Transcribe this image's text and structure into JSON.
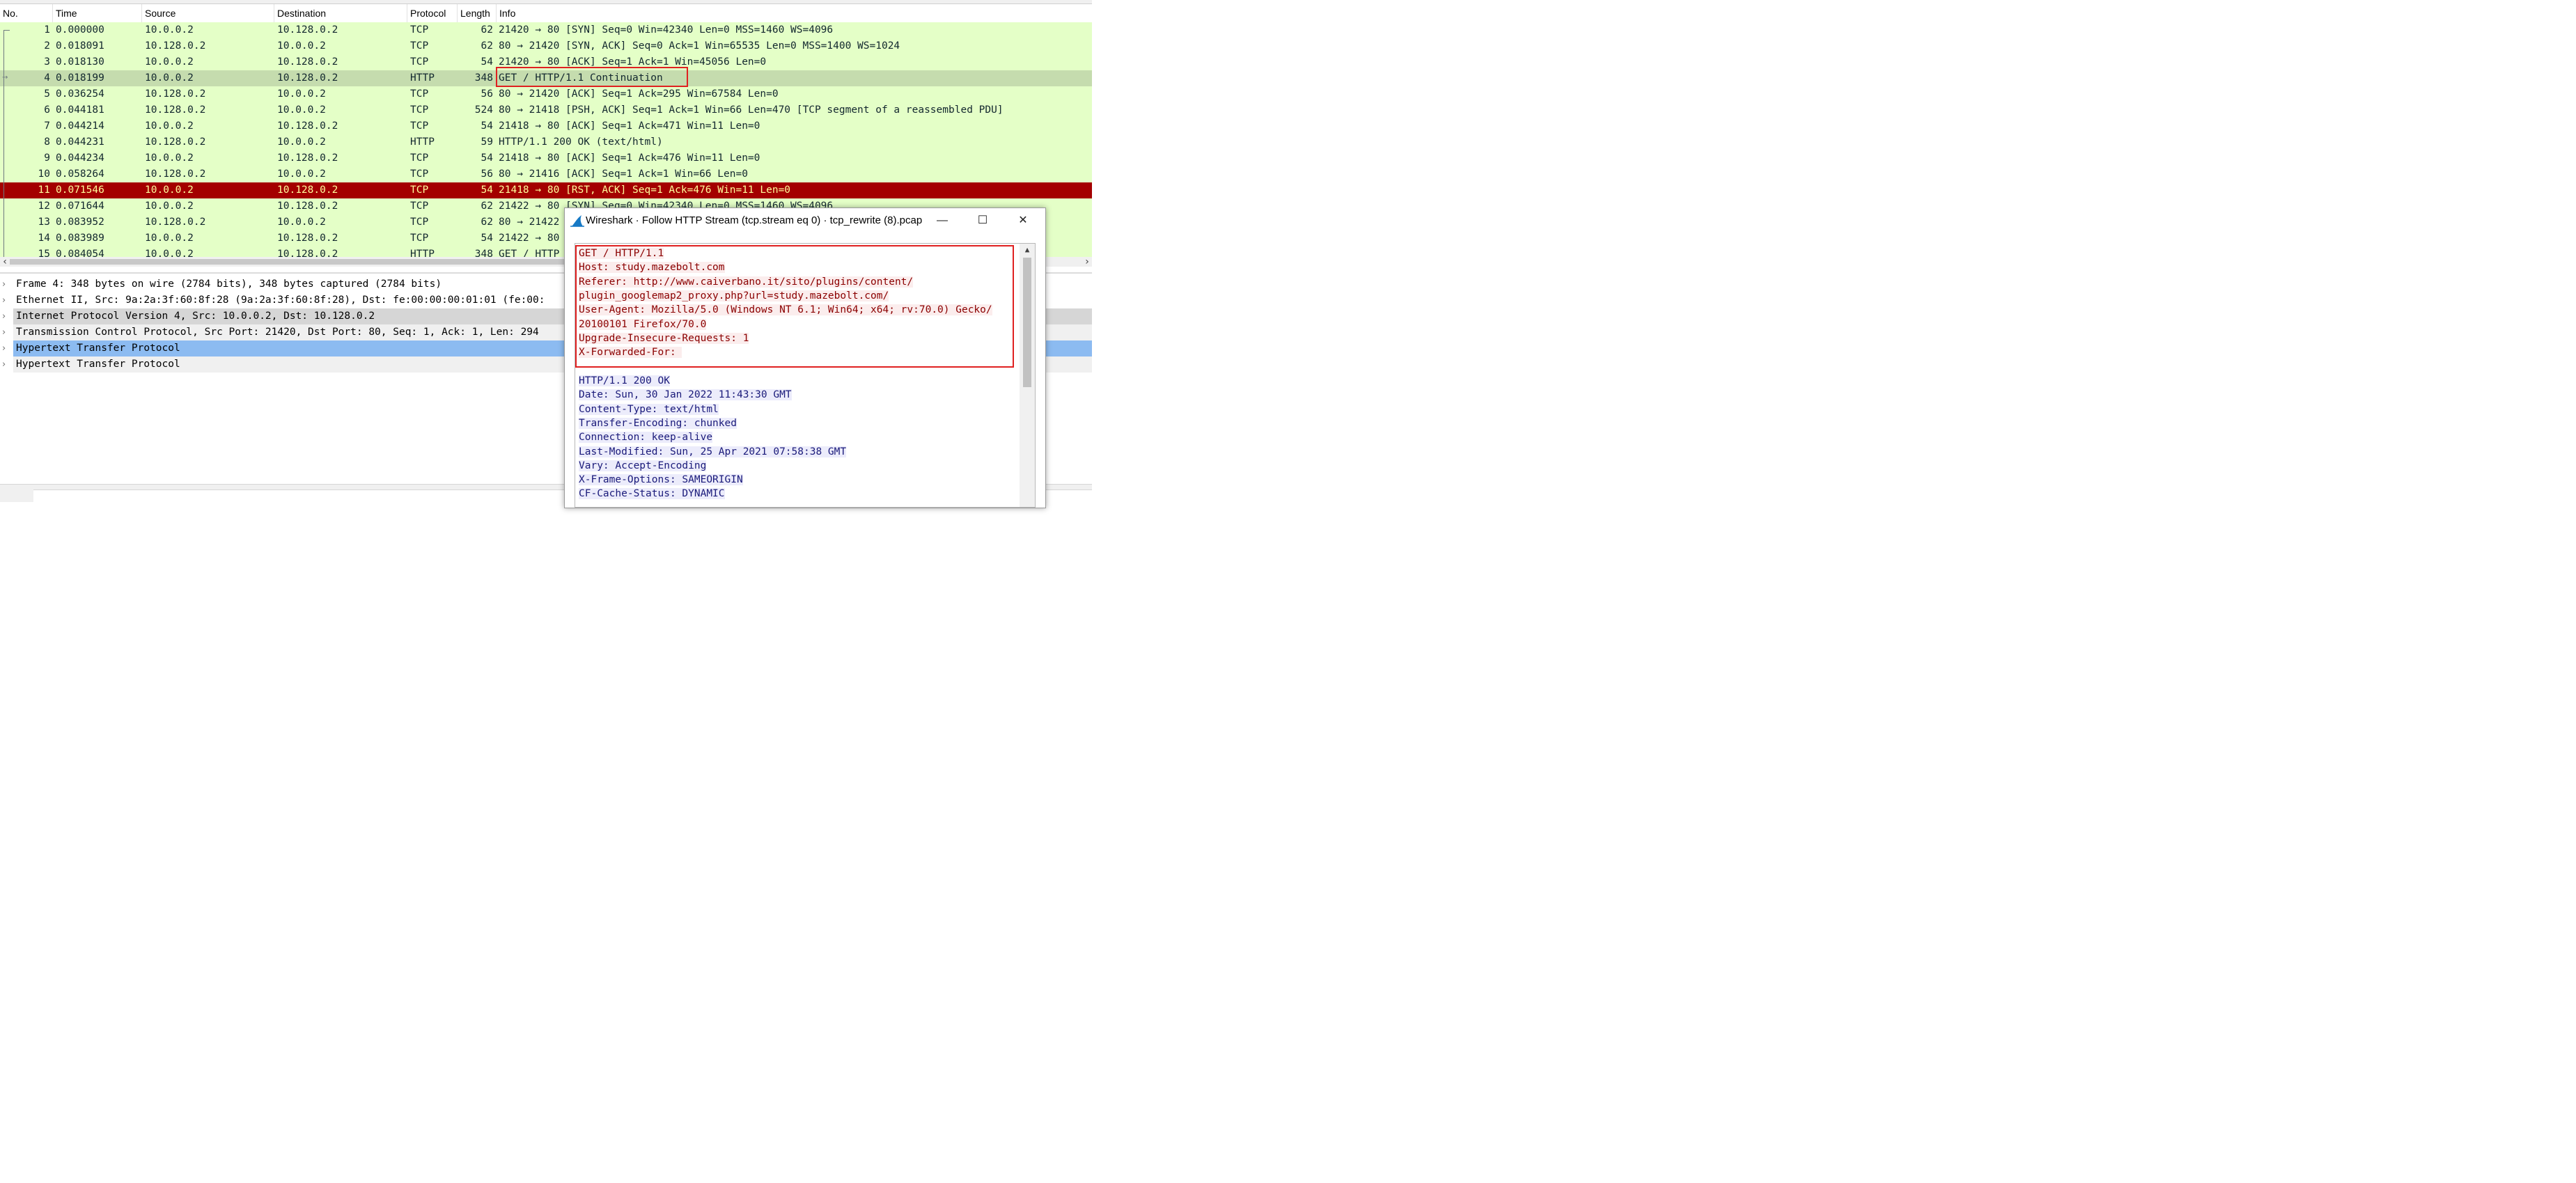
{
  "packet_list": {
    "columns": [
      "No.",
      "Time",
      "Source",
      "Destination",
      "Protocol",
      "Length",
      "Info"
    ],
    "rows": [
      {
        "no": "1",
        "time": "0.000000",
        "src": "10.0.0.2",
        "dst": "10.128.0.2",
        "proto": "TCP",
        "len": "62",
        "info": "21420 → 80 [SYN] Seq=0 Win=42340 Len=0 MSS=1460 WS=4096"
      },
      {
        "no": "2",
        "time": "0.018091",
        "src": "10.128.0.2",
        "dst": "10.0.0.2",
        "proto": "TCP",
        "len": "62",
        "info": "80 → 21420 [SYN, ACK] Seq=0 Ack=1 Win=65535 Len=0 MSS=1400 WS=1024"
      },
      {
        "no": "3",
        "time": "0.018130",
        "src": "10.0.0.2",
        "dst": "10.128.0.2",
        "proto": "TCP",
        "len": "54",
        "info": "21420 → 80 [ACK] Seq=1 Ack=1 Win=45056 Len=0"
      },
      {
        "no": "4",
        "time": "0.018199",
        "src": "10.0.0.2",
        "dst": "10.128.0.2",
        "proto": "HTTP",
        "len": "348",
        "info": "GET / HTTP/1.1 Continuation"
      },
      {
        "no": "5",
        "time": "0.036254",
        "src": "10.128.0.2",
        "dst": "10.0.0.2",
        "proto": "TCP",
        "len": "56",
        "info": "80 → 21420 [ACK] Seq=1 Ack=295 Win=67584 Len=0"
      },
      {
        "no": "6",
        "time": "0.044181",
        "src": "10.128.0.2",
        "dst": "10.0.0.2",
        "proto": "TCP",
        "len": "524",
        "info": "80 → 21418 [PSH, ACK] Seq=1 Ack=1 Win=66 Len=470 [TCP segment of a reassembled PDU]"
      },
      {
        "no": "7",
        "time": "0.044214",
        "src": "10.0.0.2",
        "dst": "10.128.0.2",
        "proto": "TCP",
        "len": "54",
        "info": "21418 → 80 [ACK] Seq=1 Ack=471 Win=11 Len=0"
      },
      {
        "no": "8",
        "time": "0.044231",
        "src": "10.128.0.2",
        "dst": "10.0.0.2",
        "proto": "HTTP",
        "len": "59",
        "info": "HTTP/1.1 200 OK  (text/html)"
      },
      {
        "no": "9",
        "time": "0.044234",
        "src": "10.0.0.2",
        "dst": "10.128.0.2",
        "proto": "TCP",
        "len": "54",
        "info": "21418 → 80 [ACK] Seq=1 Ack=476 Win=11 Len=0"
      },
      {
        "no": "10",
        "time": "0.058264",
        "src": "10.128.0.2",
        "dst": "10.0.0.2",
        "proto": "TCP",
        "len": "56",
        "info": "80 → 21416 [ACK] Seq=1 Ack=1 Win=66 Len=0"
      },
      {
        "no": "11",
        "time": "0.071546",
        "src": "10.0.0.2",
        "dst": "10.128.0.2",
        "proto": "TCP",
        "len": "54",
        "info": "21418 → 80 [RST, ACK] Seq=1 Ack=476 Win=11 Len=0"
      },
      {
        "no": "12",
        "time": "0.071644",
        "src": "10.0.0.2",
        "dst": "10.128.0.2",
        "proto": "TCP",
        "len": "62",
        "info": "21422 → 80 [SYN] Seq=0 Win=42340 Len=0 MSS=1460 WS=4096"
      },
      {
        "no": "13",
        "time": "0.083952",
        "src": "10.128.0.2",
        "dst": "10.0.0.2",
        "proto": "TCP",
        "len": "62",
        "info": "80 → 21422"
      },
      {
        "no": "14",
        "time": "0.083989",
        "src": "10.0.0.2",
        "dst": "10.128.0.2",
        "proto": "TCP",
        "len": "54",
        "info": "21422 → 80"
      },
      {
        "no": "15",
        "time": "0.084054",
        "src": "10.0.0.2",
        "dst": "10.128.0.2",
        "proto": "HTTP",
        "len": "348",
        "info": "GET / HTTP"
      }
    ],
    "selected_row": "4",
    "error_row": "11"
  },
  "details": {
    "rows": [
      "Frame 4: 348 bytes on wire (2784 bits), 348 bytes captured (2784 bits)",
      "Ethernet II, Src: 9a:2a:3f:60:8f:28 (9a:2a:3f:60:8f:28), Dst: fe:00:00:00:01:01 (fe:00:",
      "Internet Protocol Version 4, Src: 10.0.0.2, Dst: 10.128.0.2",
      "Transmission Control Protocol, Src Port: 21420, Dst Port: 80, Seq: 1, Ack: 1, Len: 294",
      "Hypertext Transfer Protocol",
      "Hypertext Transfer Protocol"
    ]
  },
  "dialog": {
    "title": "Wireshark · Follow HTTP Stream (tcp.stream eq 0) · tcp_rewrite (8).pcap",
    "minimize": "—",
    "maximize": "☐",
    "close": "✕",
    "request_lines": [
      "GET / HTTP/1.1",
      "Host: study.mazebolt.com",
      "Referer: http://www.caiverbano.it/sito/plugins/content/",
      "plugin_googlemap2_proxy.php?url=study.mazebolt.com/",
      "User-Agent: Mozilla/5.0 (Windows NT 6.1; Win64; x64; rv:70.0) Gecko/",
      "20100101 Firefox/70.0",
      "Upgrade-Insecure-Requests: 1",
      "X-Forwarded-For: "
    ],
    "response_lines": [
      "HTTP/1.1 200 OK",
      "Date: Sun, 30 Jan 2022 11:43:30 GMT",
      "Content-Type: text/html",
      "Transfer-Encoding: chunked",
      "Connection: keep-alive",
      "Last-Modified: Sun, 25 Apr 2021 07:58:38 GMT",
      "Vary: Accept-Encoding",
      "X-Frame-Options: SAMEORIGIN",
      "CF-Cache-Status: DYNAMIC"
    ]
  },
  "colors": {
    "tcp_row": "#e4ffc7",
    "selected_row": "#c5dcae",
    "error_row": "#a40000",
    "error_text": "#fffc9c",
    "detail_highlight": "#8cbbf1",
    "annotation_box": "#e02020",
    "request_text": "#8b0000",
    "response_text": "#1a1a7a"
  },
  "icons": {
    "dialog_icon": "shark-fin-icon",
    "expand": "chevron-right-icon"
  }
}
